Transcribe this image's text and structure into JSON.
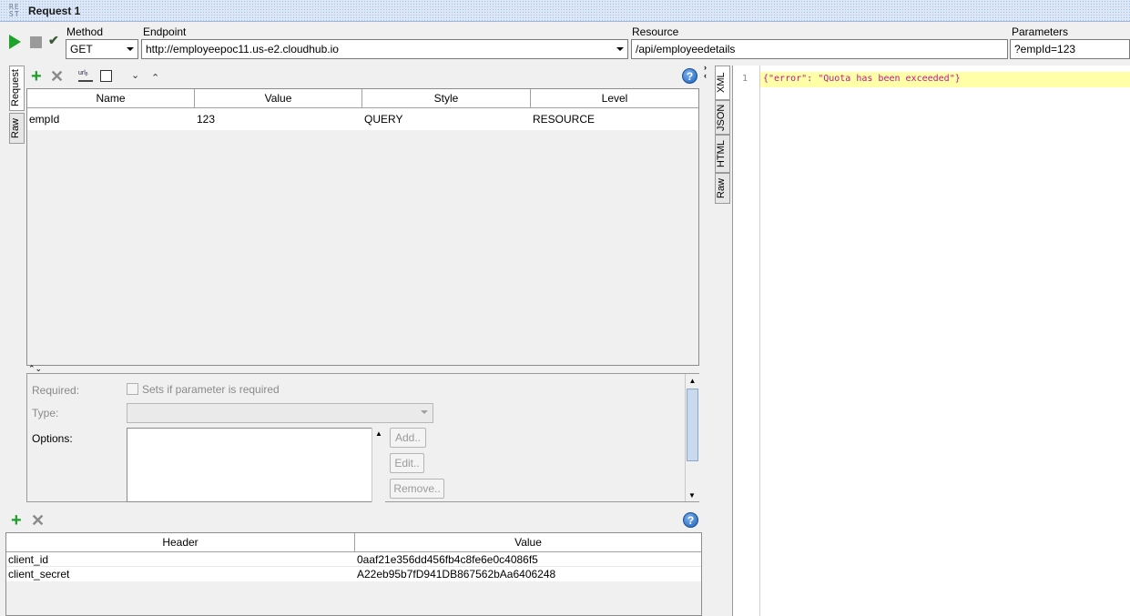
{
  "window": {
    "title": "Request 1",
    "icon_text": "RE\nST"
  },
  "toolbar": {
    "method_label": "Method",
    "method_value": "GET",
    "endpoint_label": "Endpoint",
    "endpoint_value": "http://employeepoc11.us-e2.cloudhub.io",
    "resource_label": "Resource",
    "resource_value": "/api/employeedetails",
    "parameters_label": "Parameters",
    "parameters_value": "?empId=123"
  },
  "request_tabs": [
    "Request",
    "Raw"
  ],
  "params_table": {
    "columns": [
      "Name",
      "Value",
      "Style",
      "Level"
    ],
    "rows": [
      {
        "name": "empId",
        "value": "123",
        "style": "QUERY",
        "level": "RESOURCE"
      }
    ]
  },
  "param_details": {
    "required_label": "Required:",
    "required_checkbox_text": "Sets if parameter is required",
    "type_label": "Type:",
    "options_label": "Options:",
    "add_label": "Add..",
    "edit_label": "Edit..",
    "remove_label": "Remove.."
  },
  "headers_table": {
    "columns": [
      "Header",
      "Value"
    ],
    "rows": [
      {
        "header": "client_id",
        "value": "0aaf21e356dd456fb4c8fe6e0c4086f5"
      },
      {
        "header": "client_secret",
        "value": "A22eb95b7fD941DB867562bAa6406248"
      }
    ]
  },
  "response_tabs": [
    "XML",
    "JSON",
    "HTML",
    "Raw"
  ],
  "response": {
    "line_number": "1",
    "content": "{\"error\": \"Quota has been exceeded\"}"
  },
  "colors": {
    "accent_green": "#1e9e2a",
    "json_text": "#c0168c",
    "line_highlight": "#ffffa8"
  }
}
